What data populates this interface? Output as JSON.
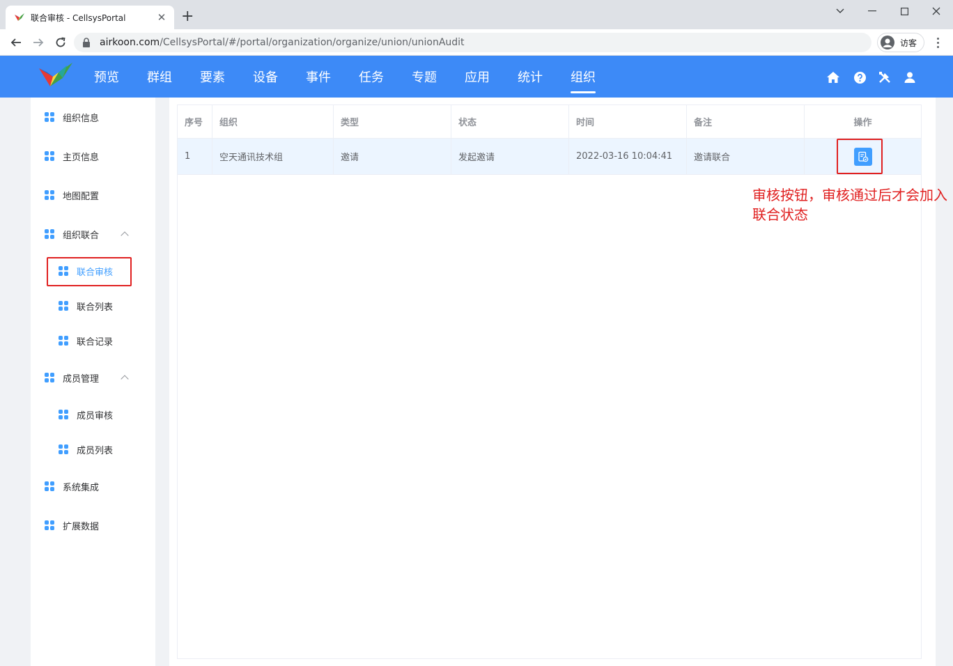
{
  "browser": {
    "tab_title": "联合审核 - CellsysPortal",
    "url_host": "airkoon.com",
    "url_path": "/CellsysPortal/#/portal/organization/organize/union/unionAudit",
    "profile_label": "访客"
  },
  "header": {
    "nav": [
      "预览",
      "群组",
      "要素",
      "设备",
      "事件",
      "任务",
      "专题",
      "应用",
      "统计",
      "组织"
    ],
    "active_nav": "组织",
    "icons": [
      "home-icon",
      "help-icon",
      "tools-icon",
      "user-icon"
    ],
    "accent_color": "#3d8af7"
  },
  "sidebar": {
    "items": [
      {
        "label": "组织信息"
      },
      {
        "label": "主页信息"
      },
      {
        "label": "地图配置"
      },
      {
        "label": "组织联合",
        "expanded": true
      },
      {
        "label": "联合审核",
        "active": true
      },
      {
        "label": "联合列表"
      },
      {
        "label": "联合记录"
      },
      {
        "label": "成员管理",
        "expanded": true
      },
      {
        "label": "成员审核"
      },
      {
        "label": "成员列表"
      },
      {
        "label": "系统集成"
      },
      {
        "label": "扩展数据"
      }
    ]
  },
  "table": {
    "columns": [
      "序号",
      "组织",
      "类型",
      "状态",
      "时间",
      "备注",
      "操作"
    ],
    "rows": [
      {
        "index": "1",
        "org": "空天通讯技术组",
        "type": "邀请",
        "status": "发起邀请",
        "time": "2022-03-16 10:04:41",
        "remark": "邀请联合"
      }
    ]
  },
  "annotation": {
    "text": "审核按钮，审核通过后才会加入联合状态",
    "color": "#e02020"
  }
}
